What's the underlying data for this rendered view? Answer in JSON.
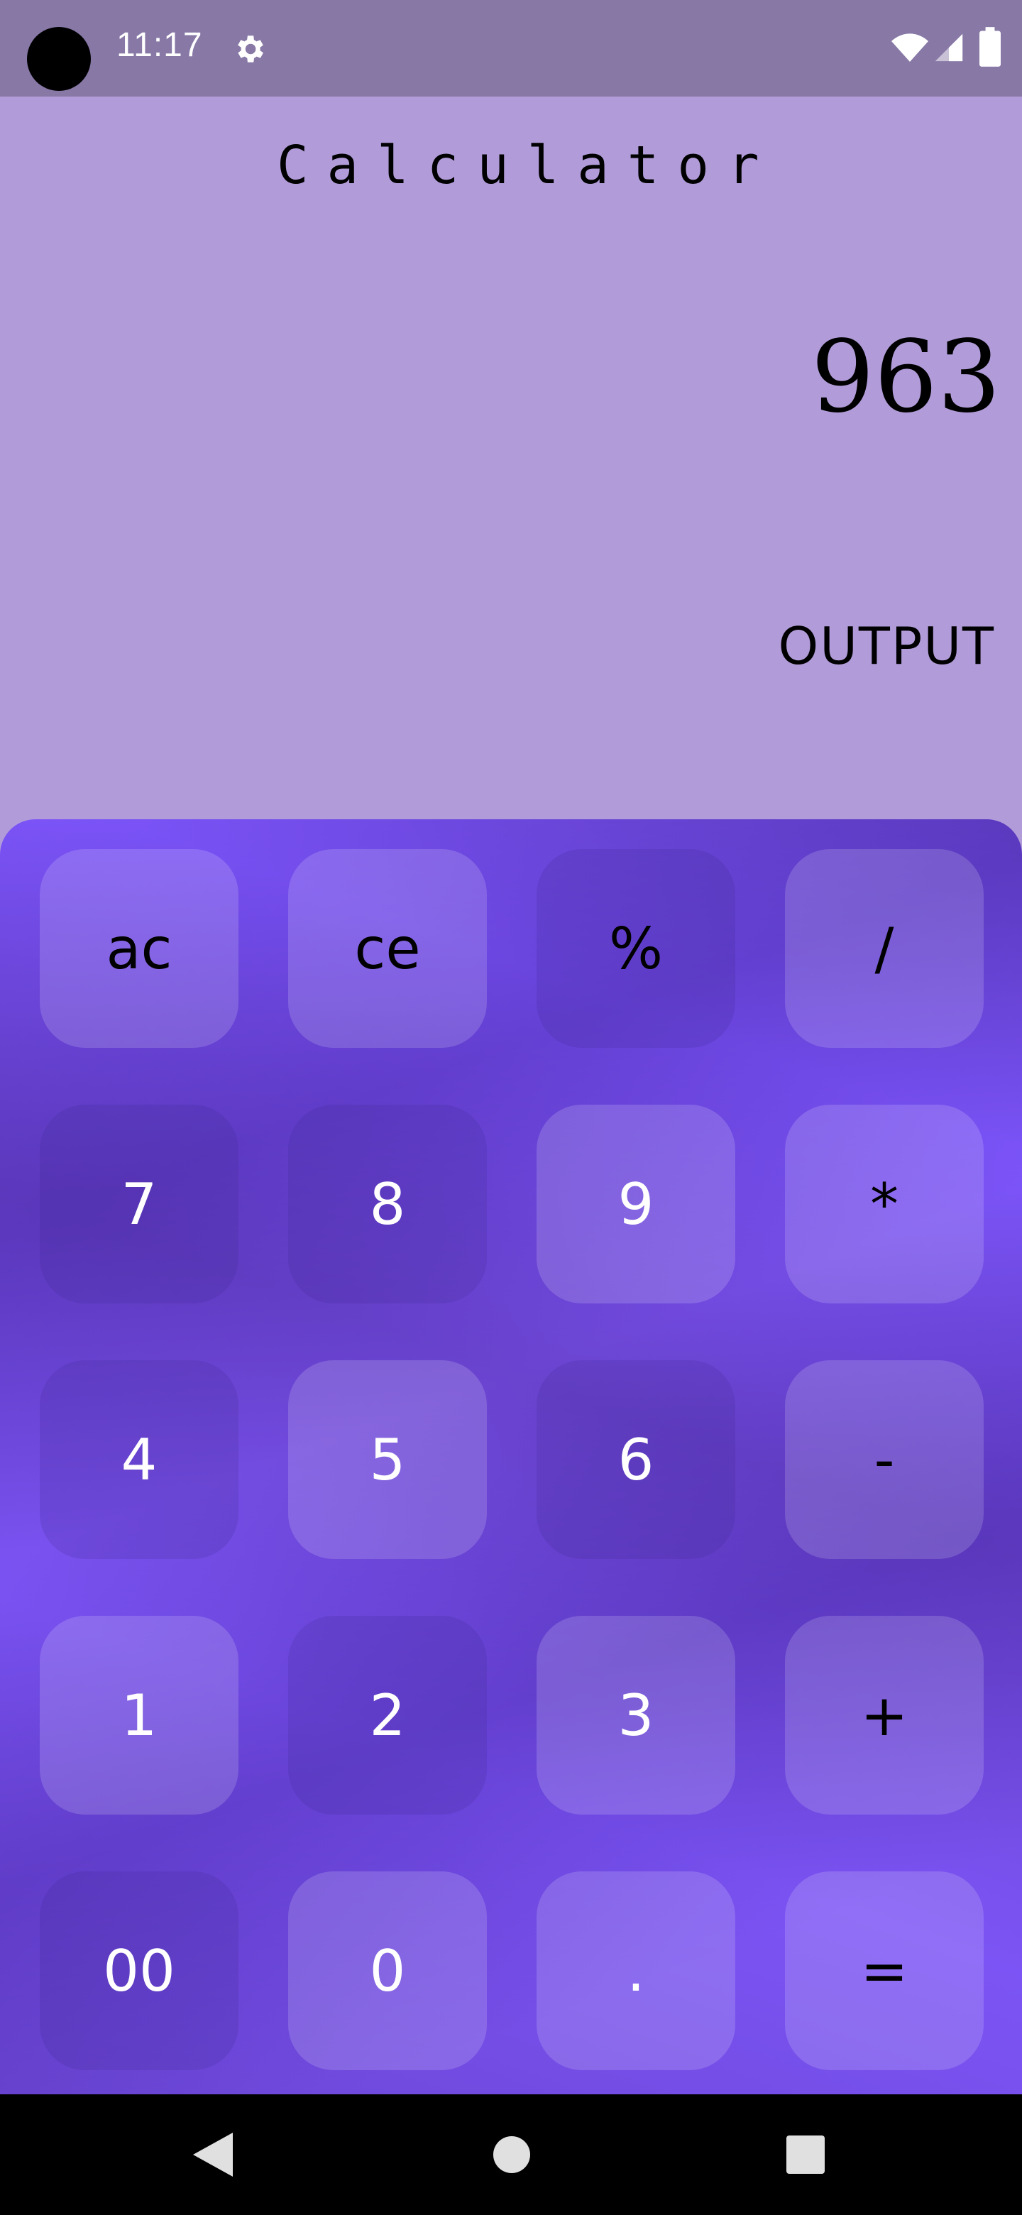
{
  "status_bar": {
    "time": "11:17",
    "icons": [
      "settings-icon",
      "wifi-icon",
      "signal-icon",
      "battery-icon"
    ]
  },
  "app": {
    "title": "Calculator",
    "display_value": "963",
    "output_label": "OUTPUT"
  },
  "keypad": {
    "rows": [
      [
        "ac",
        "ce",
        "%",
        "/"
      ],
      [
        "7",
        "8",
        "9",
        "*"
      ],
      [
        "4",
        "5",
        "6",
        "-"
      ],
      [
        "1",
        "2",
        "3",
        "+"
      ],
      [
        "00",
        "0",
        ".",
        "="
      ]
    ]
  },
  "nav_bar": {
    "icons": [
      "back-icon",
      "home-icon",
      "recents-icon"
    ]
  },
  "colors": {
    "status_bar": "#8778a6",
    "display_bg": "#b19cd9",
    "keypad_accent": "#7c54f5",
    "nav_bar": "#000000"
  }
}
